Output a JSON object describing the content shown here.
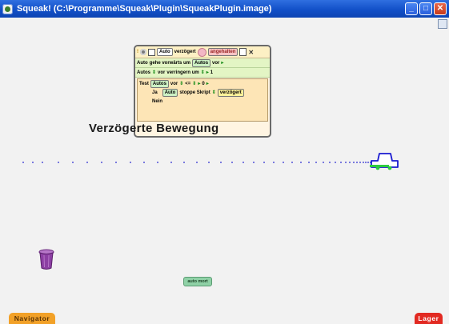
{
  "window": {
    "title": "Squeak! (C:\\Programme\\Squeak\\Plugin\\SqueakPlugin.image)",
    "buttons": {
      "minimize": "_",
      "maximize": "□",
      "close": "✕"
    }
  },
  "script": {
    "object": "Auto",
    "name": "verzögert",
    "status": "angehalten",
    "line1": {
      "object": "Auto",
      "command": "gehe vorwärts um",
      "arg_object": "Autos",
      "arg_field": "vor"
    },
    "line2": {
      "object": "Autos",
      "field": "vor",
      "command": "verringern um",
      "value": "1"
    },
    "test": {
      "label": "Test",
      "object": "Autos",
      "field": "vor",
      "operator": "<=",
      "value": "0",
      "yes_label": "Ja",
      "yes_object": "Auto",
      "yes_command": "stoppe Skript",
      "yes_script": "verzögert",
      "no_label": "Nein"
    }
  },
  "title_text": "Verzögerte Bewegung",
  "auto_mort_label": "auto mort",
  "flaps": {
    "navigator": "Navigator",
    "lager": "Lager"
  },
  "colors": {
    "titlebar": "#1250c8",
    "navigator_flap": "#f2a128",
    "lager_flap": "#e22a22",
    "car": "#1a1ad0",
    "car_wheels": "#2ecc40",
    "trash": "#8c3fa3"
  },
  "icons": [
    "squeak-app-icon",
    "gear-icon",
    "checkbox-icon",
    "status-light-icon",
    "menu-icon",
    "close-icon",
    "trash-icon",
    "car-icon"
  ]
}
